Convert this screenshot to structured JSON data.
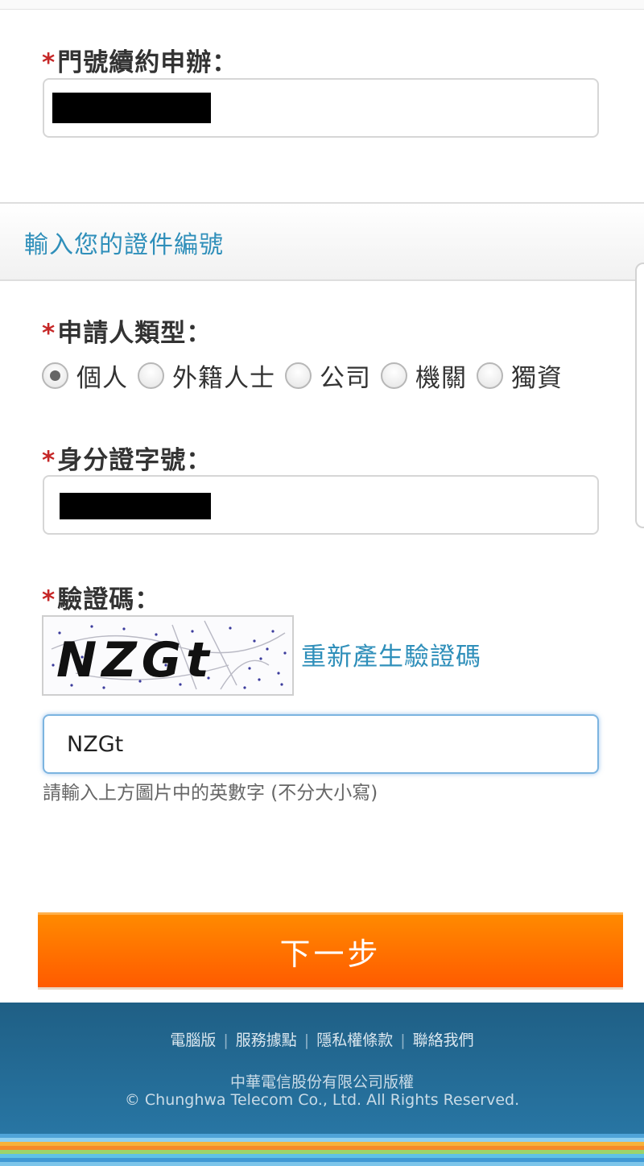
{
  "renewal": {
    "required_mark": "*",
    "label": "門號續約申辦：",
    "value": ""
  },
  "section": {
    "title": "輸入您的證件編號"
  },
  "applicant_type": {
    "required_mark": "*",
    "label": "申請人類型：",
    "options": [
      {
        "label": "個人",
        "checked": true
      },
      {
        "label": "外籍人士",
        "checked": false
      },
      {
        "label": "公司",
        "checked": false
      },
      {
        "label": "機關",
        "checked": false
      },
      {
        "label": "獨資",
        "checked": false
      }
    ]
  },
  "id_number": {
    "required_mark": "*",
    "label": "身分證字號：",
    "value": ""
  },
  "captcha": {
    "required_mark": "*",
    "label": "驗證碼：",
    "image_text": "NZGt",
    "regenerate_label": "重新產生驗證碼",
    "input_value": "NZGt",
    "hint": "請輸入上方圖片中的英數字 (不分大小寫)"
  },
  "next_button": {
    "label": "下一步"
  },
  "footer": {
    "links": [
      "電腦版",
      "服務據點",
      "隱私權條款",
      "聯絡我們"
    ],
    "separator": "|",
    "copyright_cn": "中華電信股份有限公司版權",
    "copyright_en": "© Chunghwa Telecom Co., Ltd. All Rights Reserved."
  },
  "colors": {
    "accent_link": "#2f8fba",
    "required": "#c62828",
    "button_top": "#ff8a00",
    "button_bottom": "#ff5a00",
    "footer_top": "#1f5f85",
    "footer_bottom": "#2a7bab"
  }
}
